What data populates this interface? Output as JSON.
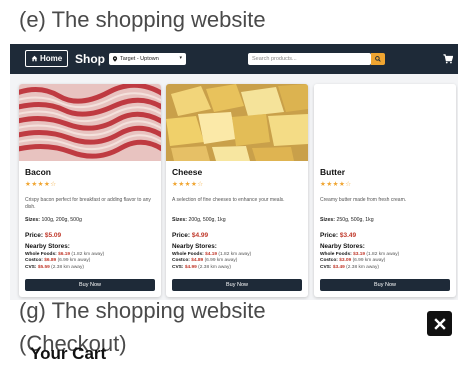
{
  "captions": {
    "top": "(e) The shopping website",
    "bottom_line1": "(g) The shopping website",
    "bottom_line2": "(Checkout)"
  },
  "navbar": {
    "home_label": "Home",
    "brand": "Shop",
    "store_select_value": "Target - Uptown",
    "search_placeholder": "Search products..."
  },
  "products": [
    {
      "name": "Bacon",
      "stars": "★★★★☆",
      "description": "Crispy bacon perfect for breakfast or adding flavor to any dish.",
      "sizes_label": "Sizes:",
      "sizes": "100g, 200g, 500g",
      "price_label": "Price:",
      "price": "$5.09",
      "nearby_label": "Nearby Stores:",
      "stores": [
        {
          "name": "Whole Foods:",
          "price": "$6.19",
          "dist": "(1.82 km away)"
        },
        {
          "name": "Costco:",
          "price": "$6.89",
          "dist": "(6.99 km away)"
        },
        {
          "name": "CVS:",
          "price": "$5.59",
          "dist": "(2.38 km away)"
        }
      ],
      "buy_label": "Buy Now"
    },
    {
      "name": "Cheese",
      "stars": "★★★★☆",
      "description": "A selection of fine cheeses to enhance your meals.",
      "sizes_label": "Sizes:",
      "sizes": "200g, 500g, 1kg",
      "price_label": "Price:",
      "price": "$4.99",
      "nearby_label": "Nearby Stores:",
      "stores": [
        {
          "name": "Whole Foods:",
          "price": "$4.19",
          "dist": "(1.82 km away)"
        },
        {
          "name": "Costco:",
          "price": "$4.89",
          "dist": "(6.99 km away)"
        },
        {
          "name": "CVS:",
          "price": "$4.99",
          "dist": "(2.38 km away)"
        }
      ],
      "buy_label": "Buy Now"
    },
    {
      "name": "Butter",
      "stars": "★★★★☆",
      "description": "Creamy butter made from fresh cream.",
      "sizes_label": "Sizes:",
      "sizes": "250g, 500g, 1kg",
      "price_label": "Price:",
      "price": "$3.49",
      "nearby_label": "Nearby Stores:",
      "stores": [
        {
          "name": "Whole Foods:",
          "price": "$3.19",
          "dist": "(1.82 km away)"
        },
        {
          "name": "Costco:",
          "price": "$3.09",
          "dist": "(6.99 km away)"
        },
        {
          "name": "CVS:",
          "price": "$3.49",
          "dist": "(2.38 km away)"
        }
      ],
      "buy_label": "Buy Now"
    }
  ],
  "checkout": {
    "title": "Your Cart"
  },
  "colors": {
    "navbar": "#1e2a38",
    "accent": "#f0a531",
    "price": "#c0392b"
  }
}
